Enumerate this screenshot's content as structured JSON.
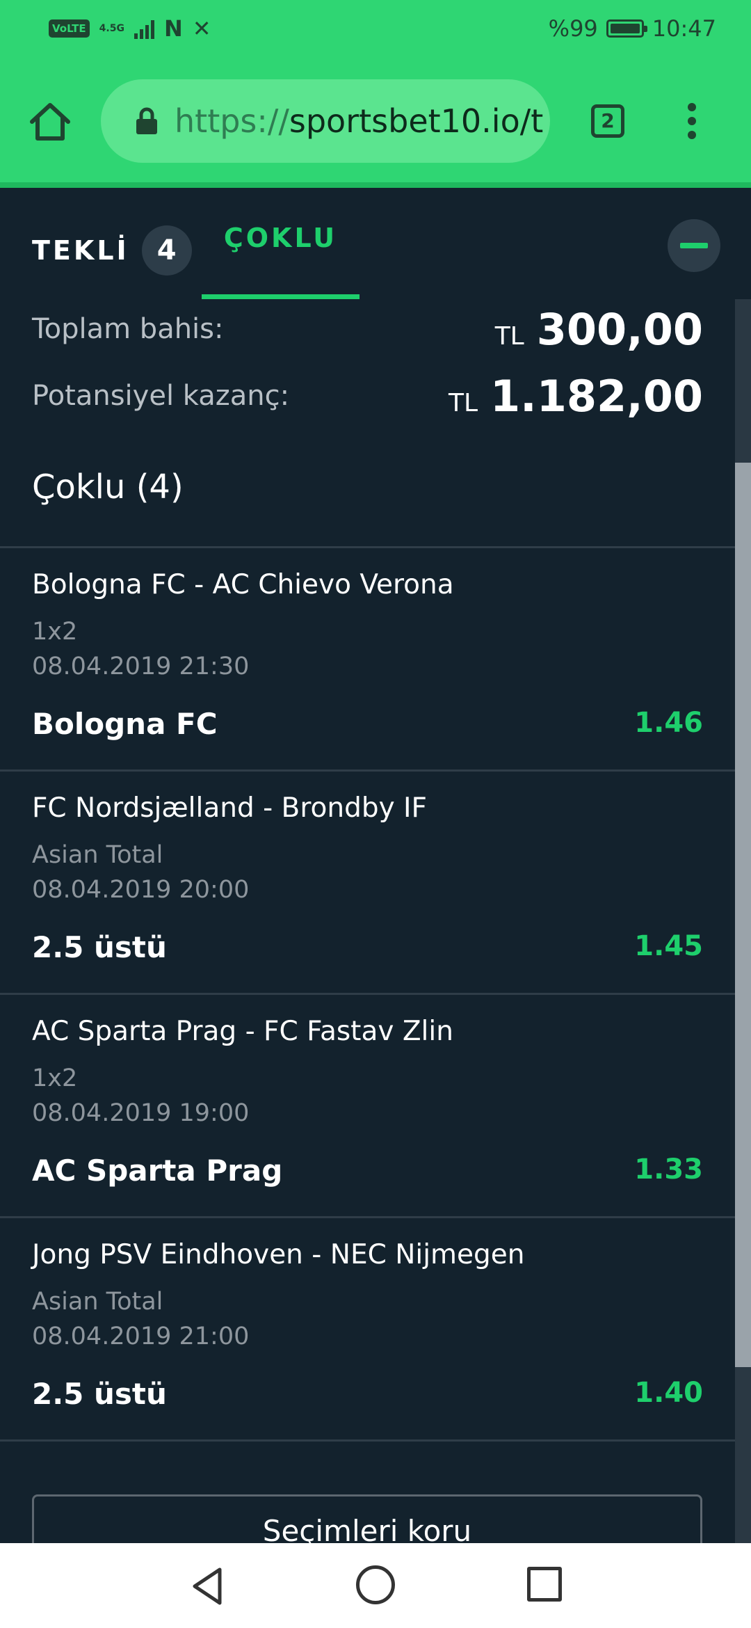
{
  "status_bar": {
    "volte": "VoLTE",
    "network": "4.5G",
    "battery_text": "%99",
    "time": "10:47"
  },
  "browser": {
    "url_scheme": "https://",
    "url_host": "sportsbet10.io/t",
    "tab_count": "2"
  },
  "betslip": {
    "tab_single": "TEKLİ",
    "tab_single_count": "4",
    "tab_multi": "ÇOKLU",
    "active_tab": "multi",
    "total_stake_label": "Toplam bahis:",
    "total_stake_currency": "TL",
    "total_stake_value": "300,00",
    "potential_win_label": "Potansiyel kazanç:",
    "potential_win_currency": "TL",
    "potential_win_value": "1.182,00",
    "section_title": "Çoklu (4)",
    "selections": [
      {
        "event": "Bologna FC - AC Chievo Verona",
        "market": "1x2",
        "datetime": "08.04.2019 21:30",
        "pick": "Bologna FC",
        "odds": "1.46"
      },
      {
        "event": "FC Nordsjælland - Brondby IF",
        "market": "Asian Total",
        "datetime": "08.04.2019 20:00",
        "pick": "2.5 üstü",
        "odds": "1.45"
      },
      {
        "event": "AC Sparta Prag - FC Fastav Zlin",
        "market": "1x2",
        "datetime": "08.04.2019 19:00",
        "pick": "AC Sparta Prag",
        "odds": "1.33"
      },
      {
        "event": "Jong PSV Eindhoven - NEC Nijmegen",
        "market": "Asian Total",
        "datetime": "08.04.2019 21:00",
        "pick": "2.5 üstü",
        "odds": "1.40"
      }
    ],
    "keep_selections_button": "Seçimleri koru"
  },
  "colors": {
    "brand_green": "#2fd673",
    "accent_green": "#1ecf6c",
    "background": "#13222d"
  },
  "icons": [
    "home-icon",
    "lock-icon",
    "tabs-icon",
    "more-vert-icon",
    "minus-icon",
    "nav-back-icon",
    "nav-home-icon",
    "nav-recents-icon"
  ]
}
